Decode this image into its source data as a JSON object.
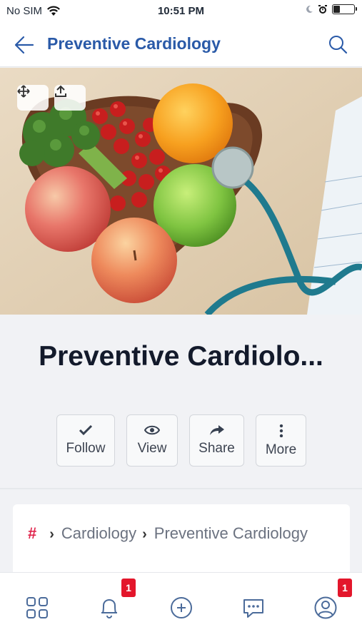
{
  "status_bar": {
    "carrier": "No SIM",
    "time": "10:51 PM",
    "battery_level": 0.3
  },
  "header": {
    "title": "Preventive Cardiology",
    "back_icon": "arrow-left-icon",
    "search_icon": "search-icon"
  },
  "hero": {
    "move_icon": "move-arrows-icon",
    "upload_icon": "upload-icon"
  },
  "page_title": "Preventive Cardiolo...",
  "actions": [
    {
      "label": "Follow",
      "icon": "check-icon"
    },
    {
      "label": "View",
      "icon": "eye-icon"
    },
    {
      "label": "Share",
      "icon": "share-arrow-icon"
    },
    {
      "label": "More",
      "icon": "vertical-dots-icon"
    }
  ],
  "breadcrumb": {
    "root_symbol": "#",
    "items": [
      "Cardiology",
      "Preventive Cardiology"
    ]
  },
  "tabbar": {
    "notifications_badge": "1",
    "profile_badge": "1"
  },
  "colors": {
    "accent": "#2a5aa8",
    "badge": "#e3162b",
    "hashtag": "#e0254c"
  }
}
